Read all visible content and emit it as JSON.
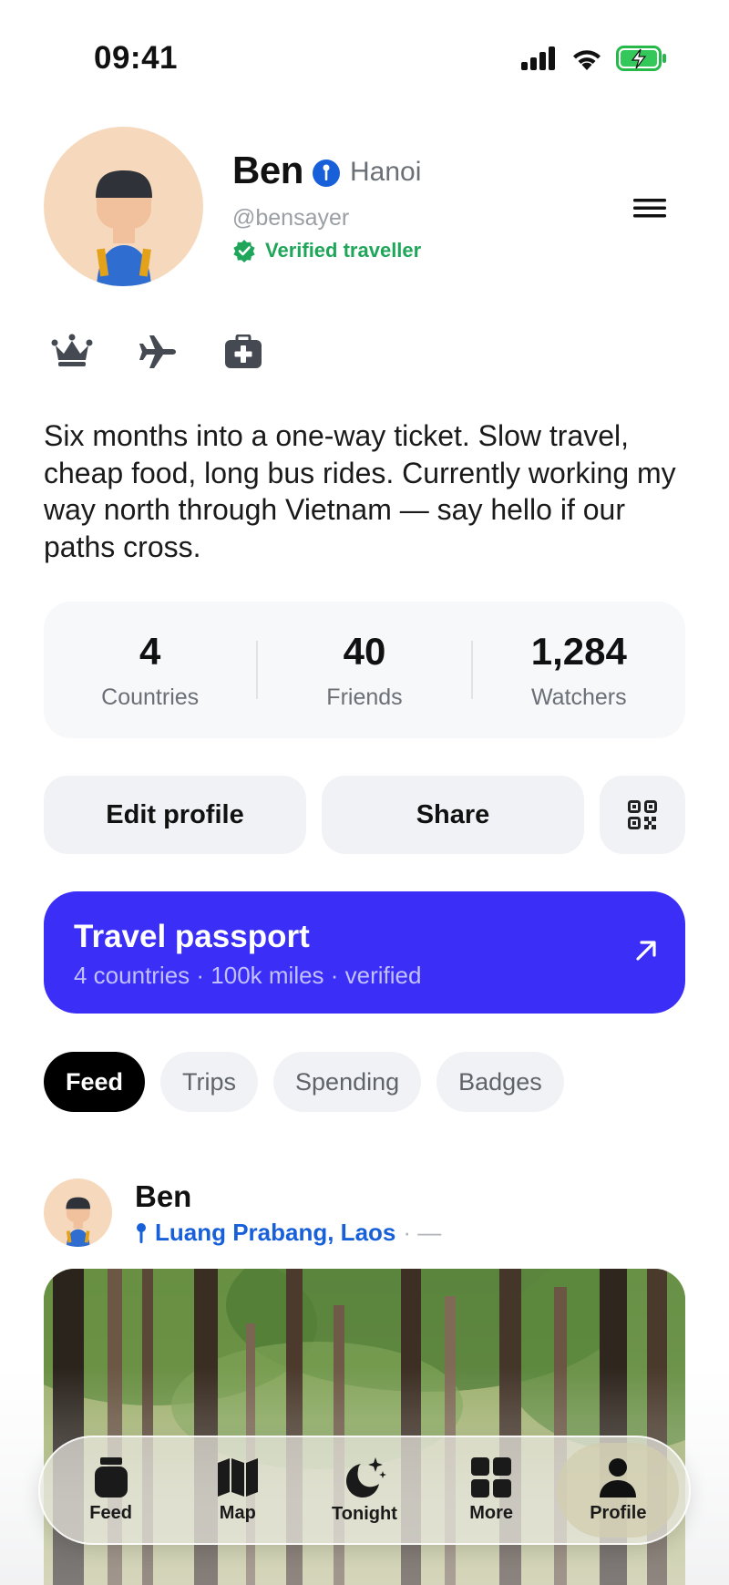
{
  "status_bar": {
    "time": "09:41"
  },
  "profile": {
    "name": "Ben",
    "city": "Hanoi",
    "handle": "@bensayer",
    "verified_label": "Verified traveller",
    "trait_icons": [
      "crown-icon",
      "airplane-icon",
      "medical-kit-icon"
    ],
    "bio": "Six months into a one-way ticket. Slow travel, cheap food, long bus rides. Currently working my way north through Vietnam — say hello if our paths cross."
  },
  "stats": [
    {
      "value": "4",
      "label": "Countries"
    },
    {
      "value": "40",
      "label": "Friends"
    },
    {
      "value": "1,284",
      "label": "Watchers"
    }
  ],
  "actions": {
    "edit": "Edit profile",
    "share": "Share",
    "qr_icon": "qr-code-icon"
  },
  "passport": {
    "title": "Travel passport",
    "subtitle": "4 countries · 100k miles · verified",
    "color": "#3a2ef7"
  },
  "tabs": [
    {
      "label": "Feed",
      "active": true
    },
    {
      "label": "Trips",
      "active": false
    },
    {
      "label": "Spending",
      "active": false
    },
    {
      "label": "Badges",
      "active": false
    }
  ],
  "post": {
    "author": "Ben",
    "location": "Luang Prabang, Laos",
    "meta": "· —"
  },
  "nav": [
    {
      "label": "Feed",
      "icon": "jar-icon",
      "active": false
    },
    {
      "label": "Map",
      "icon": "map-icon",
      "active": false
    },
    {
      "label": "Tonight",
      "icon": "moon-stars-icon",
      "active": false
    },
    {
      "label": "More",
      "icon": "grid-icon",
      "active": false
    },
    {
      "label": "Profile",
      "icon": "person-icon",
      "active": true
    }
  ],
  "colors": {
    "accent": "#3a2ef7",
    "verified": "#1fa65a",
    "link": "#1860d9"
  }
}
